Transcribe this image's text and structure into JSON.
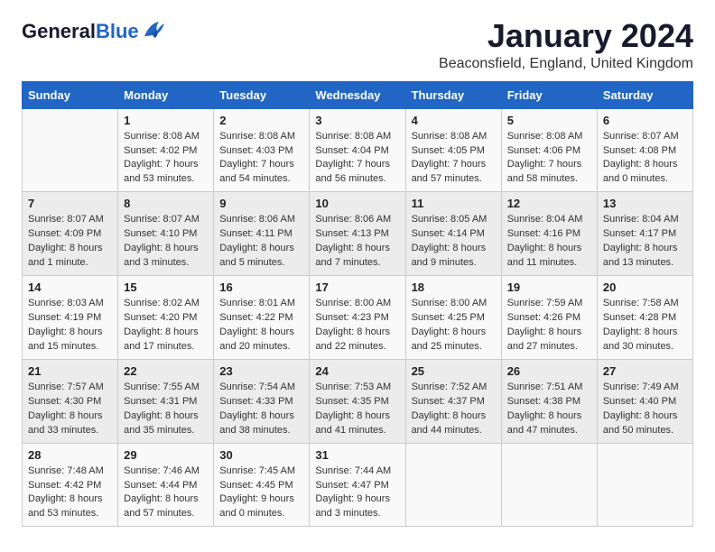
{
  "logo": {
    "general": "General",
    "blue": "Blue"
  },
  "header": {
    "month_year": "January 2024",
    "location": "Beaconsfield, England, United Kingdom"
  },
  "days_of_week": [
    "Sunday",
    "Monday",
    "Tuesday",
    "Wednesday",
    "Thursday",
    "Friday",
    "Saturday"
  ],
  "weeks": [
    [
      {
        "day": "",
        "info": ""
      },
      {
        "day": "1",
        "info": "Sunrise: 8:08 AM\nSunset: 4:02 PM\nDaylight: 7 hours\nand 53 minutes."
      },
      {
        "day": "2",
        "info": "Sunrise: 8:08 AM\nSunset: 4:03 PM\nDaylight: 7 hours\nand 54 minutes."
      },
      {
        "day": "3",
        "info": "Sunrise: 8:08 AM\nSunset: 4:04 PM\nDaylight: 7 hours\nand 56 minutes."
      },
      {
        "day": "4",
        "info": "Sunrise: 8:08 AM\nSunset: 4:05 PM\nDaylight: 7 hours\nand 57 minutes."
      },
      {
        "day": "5",
        "info": "Sunrise: 8:08 AM\nSunset: 4:06 PM\nDaylight: 7 hours\nand 58 minutes."
      },
      {
        "day": "6",
        "info": "Sunrise: 8:07 AM\nSunset: 4:08 PM\nDaylight: 8 hours\nand 0 minutes."
      }
    ],
    [
      {
        "day": "7",
        "info": "Sunrise: 8:07 AM\nSunset: 4:09 PM\nDaylight: 8 hours\nand 1 minute."
      },
      {
        "day": "8",
        "info": "Sunrise: 8:07 AM\nSunset: 4:10 PM\nDaylight: 8 hours\nand 3 minutes."
      },
      {
        "day": "9",
        "info": "Sunrise: 8:06 AM\nSunset: 4:11 PM\nDaylight: 8 hours\nand 5 minutes."
      },
      {
        "day": "10",
        "info": "Sunrise: 8:06 AM\nSunset: 4:13 PM\nDaylight: 8 hours\nand 7 minutes."
      },
      {
        "day": "11",
        "info": "Sunrise: 8:05 AM\nSunset: 4:14 PM\nDaylight: 8 hours\nand 9 minutes."
      },
      {
        "day": "12",
        "info": "Sunrise: 8:04 AM\nSunset: 4:16 PM\nDaylight: 8 hours\nand 11 minutes."
      },
      {
        "day": "13",
        "info": "Sunrise: 8:04 AM\nSunset: 4:17 PM\nDaylight: 8 hours\nand 13 minutes."
      }
    ],
    [
      {
        "day": "14",
        "info": "Sunrise: 8:03 AM\nSunset: 4:19 PM\nDaylight: 8 hours\nand 15 minutes."
      },
      {
        "day": "15",
        "info": "Sunrise: 8:02 AM\nSunset: 4:20 PM\nDaylight: 8 hours\nand 17 minutes."
      },
      {
        "day": "16",
        "info": "Sunrise: 8:01 AM\nSunset: 4:22 PM\nDaylight: 8 hours\nand 20 minutes."
      },
      {
        "day": "17",
        "info": "Sunrise: 8:00 AM\nSunset: 4:23 PM\nDaylight: 8 hours\nand 22 minutes."
      },
      {
        "day": "18",
        "info": "Sunrise: 8:00 AM\nSunset: 4:25 PM\nDaylight: 8 hours\nand 25 minutes."
      },
      {
        "day": "19",
        "info": "Sunrise: 7:59 AM\nSunset: 4:26 PM\nDaylight: 8 hours\nand 27 minutes."
      },
      {
        "day": "20",
        "info": "Sunrise: 7:58 AM\nSunset: 4:28 PM\nDaylight: 8 hours\nand 30 minutes."
      }
    ],
    [
      {
        "day": "21",
        "info": "Sunrise: 7:57 AM\nSunset: 4:30 PM\nDaylight: 8 hours\nand 33 minutes."
      },
      {
        "day": "22",
        "info": "Sunrise: 7:55 AM\nSunset: 4:31 PM\nDaylight: 8 hours\nand 35 minutes."
      },
      {
        "day": "23",
        "info": "Sunrise: 7:54 AM\nSunset: 4:33 PM\nDaylight: 8 hours\nand 38 minutes."
      },
      {
        "day": "24",
        "info": "Sunrise: 7:53 AM\nSunset: 4:35 PM\nDaylight: 8 hours\nand 41 minutes."
      },
      {
        "day": "25",
        "info": "Sunrise: 7:52 AM\nSunset: 4:37 PM\nDaylight: 8 hours\nand 44 minutes."
      },
      {
        "day": "26",
        "info": "Sunrise: 7:51 AM\nSunset: 4:38 PM\nDaylight: 8 hours\nand 47 minutes."
      },
      {
        "day": "27",
        "info": "Sunrise: 7:49 AM\nSunset: 4:40 PM\nDaylight: 8 hours\nand 50 minutes."
      }
    ],
    [
      {
        "day": "28",
        "info": "Sunrise: 7:48 AM\nSunset: 4:42 PM\nDaylight: 8 hours\nand 53 minutes."
      },
      {
        "day": "29",
        "info": "Sunrise: 7:46 AM\nSunset: 4:44 PM\nDaylight: 8 hours\nand 57 minutes."
      },
      {
        "day": "30",
        "info": "Sunrise: 7:45 AM\nSunset: 4:45 PM\nDaylight: 9 hours\nand 0 minutes."
      },
      {
        "day": "31",
        "info": "Sunrise: 7:44 AM\nSunset: 4:47 PM\nDaylight: 9 hours\nand 3 minutes."
      },
      {
        "day": "",
        "info": ""
      },
      {
        "day": "",
        "info": ""
      },
      {
        "day": "",
        "info": ""
      }
    ]
  ]
}
